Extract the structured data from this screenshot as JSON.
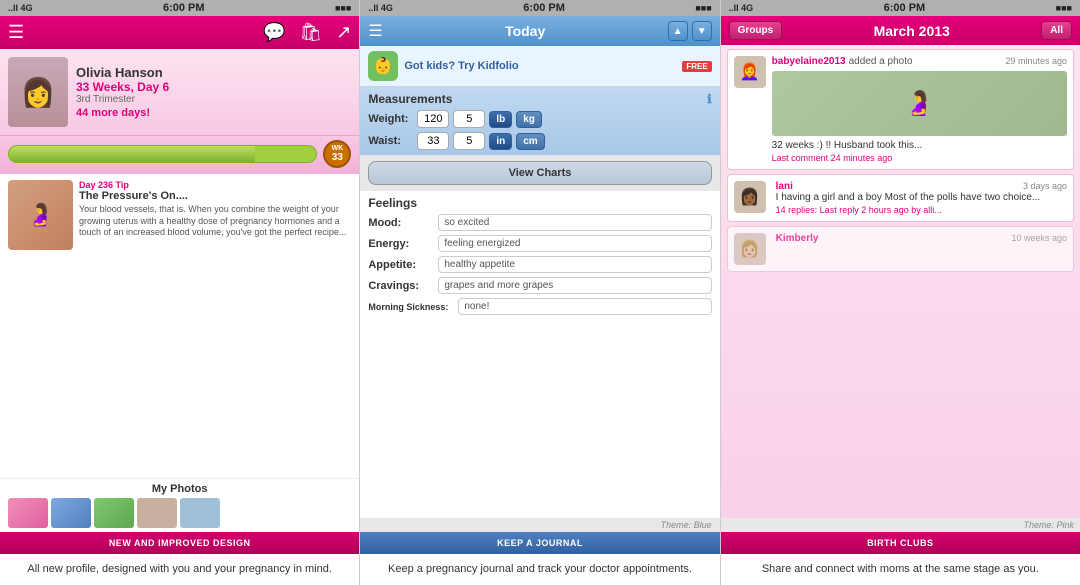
{
  "statusBar": {
    "signal": "..ll 4G",
    "time": "6:00 PM",
    "battery": "■■■"
  },
  "screen1": {
    "header": {
      "menuIcon": "☰",
      "chatIcon": "💬",
      "shopIcon": "🛍",
      "shareIcon": "↗"
    },
    "profile": {
      "name": "Olivia Hanson",
      "weeksLabel": "33 Weeks, Day 6",
      "trimester": "3rd Trimester",
      "daysLeft": "44 more days!",
      "avatarEmoji": "👩"
    },
    "progress": {
      "wkLabel": "WK",
      "wkNumber": "33",
      "fillPercent": 80
    },
    "tip": {
      "dayLabel": "Day 236 Tip",
      "title": "The Pressure's On....",
      "text": "Your blood vessels, that is. When you combine the weight of your growing uterus with a healthy dose of pregnancy hormones and a touch of an increased blood volume, you've got the perfect recipe...",
      "emoji": "🤰"
    },
    "photos": {
      "title": "My Photos"
    },
    "banner": {
      "label": "NEW AND IMPROVED DESIGN"
    },
    "caption": "All new profile, designed with you\nand your pregnancy in mind."
  },
  "screen2": {
    "header": {
      "menuIcon": "☰",
      "title": "Today",
      "upArrow": "▲",
      "downArrow": "▼"
    },
    "ad": {
      "icon": "👶",
      "text": "Got kids? Try Kidfolio",
      "freeLabel": "FREE"
    },
    "measurements": {
      "title": "Measurements",
      "weight": {
        "label": "Weight:",
        "value1": "120",
        "value2": "5",
        "unit1": "lb",
        "unit2": "kg"
      },
      "waist": {
        "label": "Waist:",
        "value1": "33",
        "value2": "5",
        "unit1": "in",
        "unit2": "cm"
      },
      "viewChartsBtn": "View Charts"
    },
    "feelings": {
      "title": "Feelings",
      "mood": {
        "label": "Mood:",
        "value": "so excited"
      },
      "energy": {
        "label": "Energy:",
        "value": "feeling energized"
      },
      "appetite": {
        "label": "Appetite:",
        "value": "healthy appetite"
      },
      "cravings": {
        "label": "Cravings:",
        "value": "grapes and more grapes"
      },
      "morningSickness": {
        "label": "Morning Sickness:",
        "value": "none!"
      }
    },
    "banner": {
      "label": "KEEP A JOURNAL"
    },
    "theme": "Theme: Blue",
    "caption": "Keep a pregnancy journal and\ntrack your doctor appointments."
  },
  "screen3": {
    "header": {
      "groupsBtn": "Groups",
      "title": "March 2013",
      "allBtn": "All"
    },
    "posts": [
      {
        "username": "babyelaine2013",
        "action": "added a photo",
        "time": "29 minutes ago",
        "avatarEmoji": "👩‍🦰",
        "hasImage": true,
        "imageEmoji": "🤰",
        "text": "32 weeks :) !! Husband took this...",
        "comment": "Last comment 24 minutes ago"
      },
      {
        "username": "lani",
        "action": "",
        "time": "3 days ago",
        "avatarEmoji": "👩🏾",
        "hasImage": false,
        "text": "I  having a girl and a boy\nMost of the polls have two choice...",
        "comment": "14 replies: Last reply 2 hours ago by alli..."
      },
      {
        "username": "Kimberly",
        "action": "",
        "time": "10 weeks ago",
        "avatarEmoji": "👩🏼",
        "hasImage": false,
        "text": "",
        "comment": ""
      }
    ],
    "banner": {
      "label": "BIRTH CLUBS"
    },
    "theme": "Theme: Pink",
    "caption": "Share and connect with moms at\nthe same stage as you."
  }
}
